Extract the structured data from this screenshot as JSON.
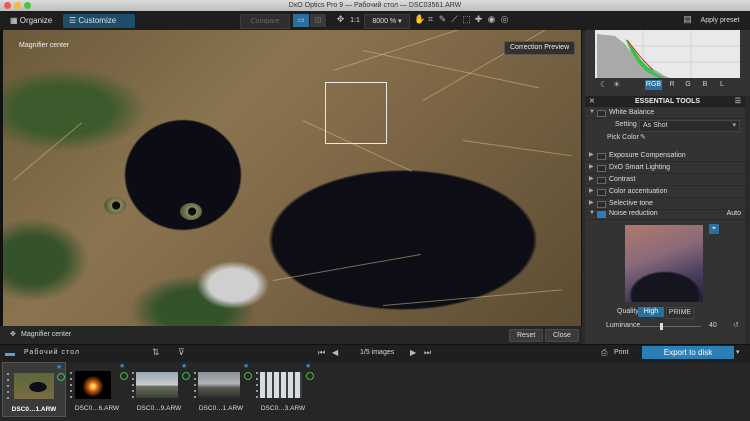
{
  "window": {
    "title": "DxO Optics Pro 9 — Рабочий стол — DSC03561.ARW"
  },
  "toolbar": {
    "tabs": [
      {
        "label": "Organize"
      },
      {
        "label": "Customize"
      }
    ],
    "compare_label": "Compare",
    "zoom_mode": "1:1",
    "zoom_value": "8000 %",
    "apply_preset_label": "Apply preset"
  },
  "viewer": {
    "magnifier_label_top": "Magnifier center",
    "correction_preview_label": "Correction Preview",
    "magnifier_label_bottom": "Magnifier center",
    "reset_label": "Reset",
    "close_label": "Close"
  },
  "histogram": {
    "channels": [
      "RGB",
      "R",
      "G",
      "B",
      "L"
    ],
    "active_channel": "RGB"
  },
  "tools": {
    "header": "ESSENTIAL TOOLS",
    "white_balance": {
      "label": "White Balance",
      "setting_label": "Setting",
      "setting_value": "As Shot",
      "pick_color_label": "Pick Color"
    },
    "items": [
      {
        "label": "Exposure Compensation"
      },
      {
        "label": "DxO Smart Lighting"
      },
      {
        "label": "Contrast"
      },
      {
        "label": "Color accentuation"
      },
      {
        "label": "Selective tone"
      }
    ],
    "noise": {
      "label": "Noise reduction",
      "mode": "Auto",
      "quality_label": "Quality",
      "quality_options": [
        "High",
        "PRIME"
      ],
      "quality_selected": "High",
      "luminance_label": "Luminance",
      "luminance_value": "40"
    }
  },
  "browser": {
    "folder": "Рабочий стол",
    "page_info": "1/5 images",
    "print_label": "Print",
    "export_label": "Export to disk"
  },
  "filmstrip": [
    {
      "name": "DSC0…1.ARW"
    },
    {
      "name": "DSC0…6.ARW"
    },
    {
      "name": "DSC0…9.ARW"
    },
    {
      "name": "DSC0…1.ARW"
    },
    {
      "name": "DSC0…3.ARW"
    }
  ],
  "colors": {
    "accent": "#2a7fb6",
    "active_tab": "#1d4d6b",
    "star": "#3a8fd0",
    "green": "#37c24a"
  }
}
